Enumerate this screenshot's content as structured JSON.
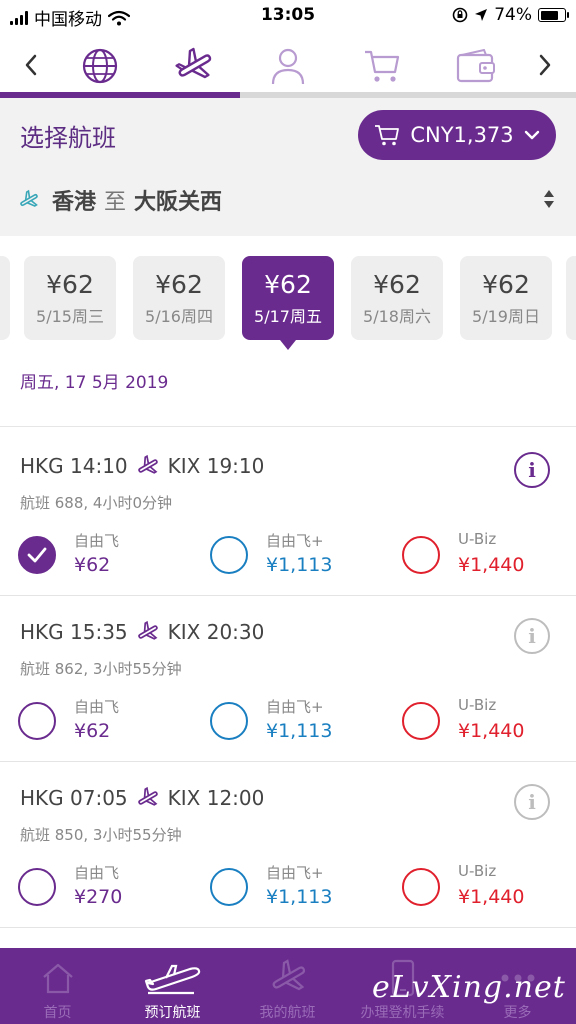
{
  "status_bar": {
    "carrier": "中国移动",
    "time": "13:05",
    "battery_text": "74%",
    "battery_level": 0.74
  },
  "step_nav": {
    "steps": [
      {
        "icon": "globe-icon"
      },
      {
        "icon": "airplane-icon",
        "active": true
      },
      {
        "icon": "passenger-icon"
      },
      {
        "icon": "cart-icon"
      },
      {
        "icon": "wallet-icon"
      }
    ]
  },
  "header": {
    "title": "选择航班",
    "total_price": "CNY1,373"
  },
  "route": {
    "origin": "香港",
    "connector": "至",
    "destination": "大阪关西"
  },
  "dates": [
    {
      "price": "¥62",
      "date": "5/15周三"
    },
    {
      "price": "¥62",
      "date": "5/16周四"
    },
    {
      "price": "¥62",
      "date": "5/17周五",
      "selected": true
    },
    {
      "price": "¥62",
      "date": "5/18周六"
    },
    {
      "price": "¥62",
      "date": "5/19周日"
    }
  ],
  "selected_date_label": "周五, 17 5月 2019",
  "flights": [
    {
      "depart": "HKG 14:10",
      "arrive": "KIX 19:10",
      "meta": "航班 688, 4小时0分钟",
      "info_active": true,
      "fares": [
        {
          "name": "自由飞",
          "price": "¥62",
          "selected": true
        },
        {
          "name": "自由飞+",
          "price": "¥1,113",
          "selected": false
        },
        {
          "name": "U-Biz",
          "price": "¥1,440",
          "selected": false
        }
      ]
    },
    {
      "depart": "HKG 15:35",
      "arrive": "KIX 20:30",
      "meta": "航班 862, 3小时55分钟",
      "info_active": false,
      "fares": [
        {
          "name": "自由飞",
          "price": "¥62",
          "selected": false
        },
        {
          "name": "自由飞+",
          "price": "¥1,113",
          "selected": false
        },
        {
          "name": "U-Biz",
          "price": "¥1,440",
          "selected": false
        }
      ]
    },
    {
      "depart": "HKG 07:05",
      "arrive": "KIX 12:00",
      "meta": "航班 850, 3小时55分钟",
      "info_active": false,
      "fares": [
        {
          "name": "自由飞",
          "price": "¥270",
          "selected": false
        },
        {
          "name": "自由飞+",
          "price": "¥1,113",
          "selected": false
        },
        {
          "name": "U-Biz",
          "price": "¥1,440",
          "selected": false
        }
      ]
    }
  ],
  "fare_colors": {
    "economy": "#6a2b8e",
    "economy_plus": "#1a7fc1",
    "ubiz": "#e0202c"
  },
  "tab_bar": {
    "tabs": [
      {
        "label": "首页",
        "icon": "home-icon"
      },
      {
        "label": "预订航班",
        "icon": "airplane-icon",
        "active": true
      },
      {
        "label": "我的航班",
        "icon": "airplane-icon"
      },
      {
        "label": "办理登机手续",
        "icon": "phone-icon"
      },
      {
        "label": "更多",
        "icon": "more-icon"
      }
    ]
  },
  "watermark": "eLvXing.net",
  "theme": {
    "brand": "#6a2b8e",
    "background": "#f2f2f2"
  }
}
